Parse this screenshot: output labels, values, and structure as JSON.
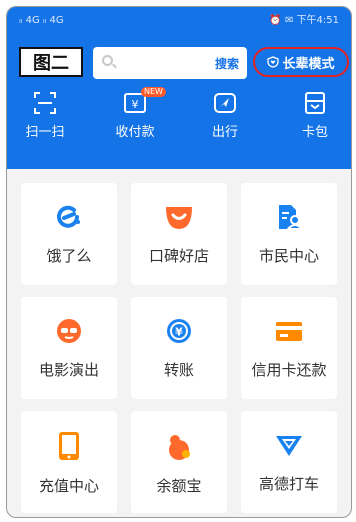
{
  "label_box": "图二",
  "status": {
    "left": "ᵢₗ 4G ᵢₗ 4G",
    "right": "⏰ ✉ 下午4:51"
  },
  "search": {
    "placeholder": "",
    "button": "搜索"
  },
  "elder_mode": {
    "label": "长辈模式",
    "border_color": "#e52222"
  },
  "quick_actions": [
    {
      "label": "扫一扫",
      "icon": "scan-icon"
    },
    {
      "label": "收付款",
      "icon": "payment-qr-icon",
      "badge": "NEW"
    },
    {
      "label": "出行",
      "icon": "travel-icon"
    },
    {
      "label": "卡包",
      "icon": "card-pack-icon"
    }
  ],
  "grid_items": [
    {
      "label": "饿了么",
      "icon": "eleme-icon",
      "color": "#1a82f0"
    },
    {
      "label": "口碑好店",
      "icon": "koubei-icon",
      "color": "#ff6a2c"
    },
    {
      "label": "市民中心",
      "icon": "citizen-center-icon",
      "color": "#1a82f0"
    },
    {
      "label": "电影演出",
      "icon": "movie-icon",
      "color": "#ff6a2c"
    },
    {
      "label": "转账",
      "icon": "transfer-icon",
      "color": "#1a82f0"
    },
    {
      "label": "信用卡还款",
      "icon": "credit-card-icon",
      "color": "#ff8a00"
    },
    {
      "label": "充值中心",
      "icon": "recharge-icon",
      "color": "#ff8a00"
    },
    {
      "label": "余额宝",
      "icon": "yuebao-icon",
      "color": "#ff6a2c"
    },
    {
      "label": "高德打车",
      "icon": "amap-taxi-icon",
      "color": "#1a82f0"
    }
  ],
  "colors": {
    "header": "#1473e6",
    "background": "#f3f3f3"
  }
}
